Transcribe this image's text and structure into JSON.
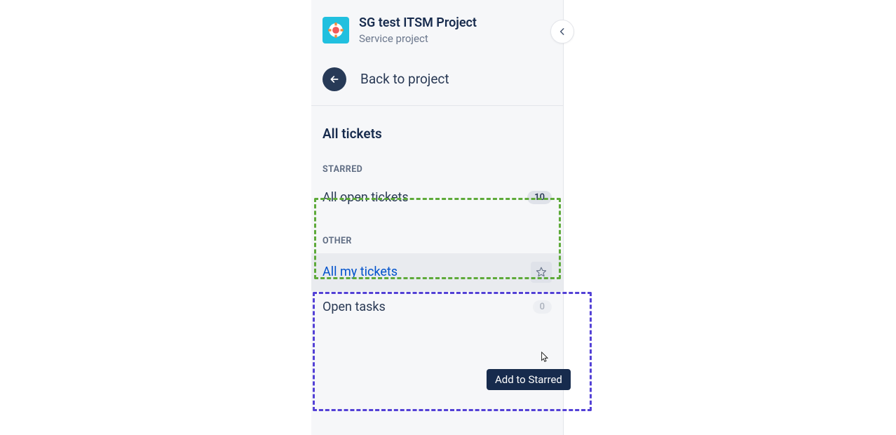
{
  "project": {
    "name": "SG test ITSM Project",
    "type": "Service project"
  },
  "back_label": "Back to project",
  "page_title": "All tickets",
  "sections": {
    "starred": {
      "header": "STARRED",
      "items": [
        {
          "label": "All open tickets",
          "count": "10"
        }
      ]
    },
    "other": {
      "header": "OTHER",
      "items": [
        {
          "label": "All my tickets"
        },
        {
          "label": "Open tasks",
          "count": "0"
        }
      ]
    }
  },
  "tooltip": "Add to Starred",
  "annotations": {
    "green_box": "starred-section-highlight",
    "purple_box": "other-section-highlight"
  },
  "colors": {
    "accent": "#0052cc",
    "highlight_green": "#5eaa3a",
    "highlight_purple": "#5341d6"
  }
}
